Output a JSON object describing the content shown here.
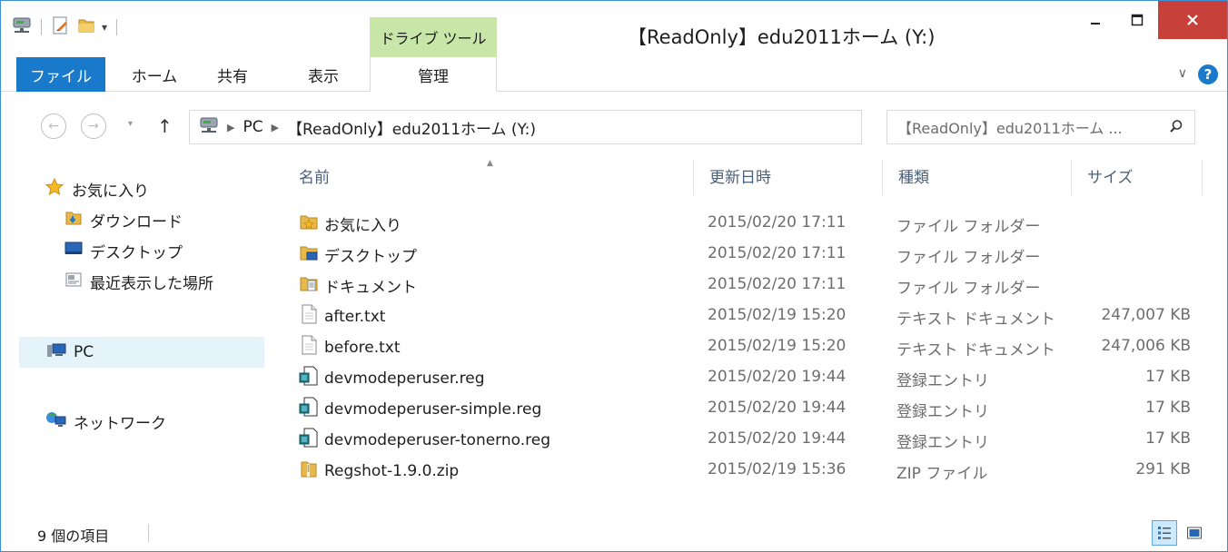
{
  "window": {
    "title": "【ReadOnly】edu2011ホーム (Y:)",
    "context_tab": "ドライブ ツール",
    "min_label": "–",
    "max_label": "☐",
    "close_label": "✕"
  },
  "ribbon": {
    "tabs": [
      "ファイル",
      "ホーム",
      "共有",
      "表示",
      "管理"
    ],
    "help_label": "?"
  },
  "nav": {
    "breadcrumb": [
      "PC",
      "【ReadOnly】edu2011ホーム (Y:)"
    ],
    "search_placeholder": "【ReadOnly】edu2011ホーム ..."
  },
  "sidebar": {
    "items": [
      {
        "label": "お気に入り",
        "icon": "star-icon"
      },
      {
        "label": "ダウンロード",
        "icon": "download-folder-icon"
      },
      {
        "label": "デスクトップ",
        "icon": "desktop-icon"
      },
      {
        "label": "最近表示した場所",
        "icon": "recent-places-icon"
      },
      {
        "label": "PC",
        "icon": "pc-icon"
      },
      {
        "label": "ネットワーク",
        "icon": "network-icon"
      }
    ]
  },
  "table": {
    "columns": [
      "名前",
      "更新日時",
      "種類",
      "サイズ"
    ],
    "rows": [
      {
        "name": "お気に入り",
        "date": "2015/02/20 17:11",
        "type": "ファイル フォルダー",
        "size": "",
        "icon": "favorites-folder-icon"
      },
      {
        "name": "デスクトップ",
        "date": "2015/02/20 17:11",
        "type": "ファイル フォルダー",
        "size": "",
        "icon": "desktop-folder-icon"
      },
      {
        "name": "ドキュメント",
        "date": "2015/02/20 17:11",
        "type": "ファイル フォルダー",
        "size": "",
        "icon": "documents-folder-icon"
      },
      {
        "name": "after.txt",
        "date": "2015/02/19 15:20",
        "type": "テキスト ドキュメント",
        "size": "247,007 KB",
        "icon": "text-file-icon"
      },
      {
        "name": "before.txt",
        "date": "2015/02/19 15:20",
        "type": "テキスト ドキュメント",
        "size": "247,006 KB",
        "icon": "text-file-icon"
      },
      {
        "name": "devmodeperuser.reg",
        "date": "2015/02/20 19:44",
        "type": "登録エントリ",
        "size": "17 KB",
        "icon": "registry-file-icon"
      },
      {
        "name": "devmodeperuser-simple.reg",
        "date": "2015/02/20 19:44",
        "type": "登録エントリ",
        "size": "17 KB",
        "icon": "registry-file-icon"
      },
      {
        "name": "devmodeperuser-tonerno.reg",
        "date": "2015/02/20 19:44",
        "type": "登録エントリ",
        "size": "17 KB",
        "icon": "registry-file-icon"
      },
      {
        "name": "Regshot-1.9.0.zip",
        "date": "2015/02/19 15:36",
        "type": "ZIP ファイル",
        "size": "291 KB",
        "icon": "zip-file-icon"
      }
    ]
  },
  "status": {
    "item_count": "9 個の項目"
  },
  "colors": {
    "accent": "#1979ca",
    "close": "#c7403a",
    "context_tab": "#c7e6a7",
    "header_text": "#4c607a",
    "selection": "#e5f3fb"
  }
}
